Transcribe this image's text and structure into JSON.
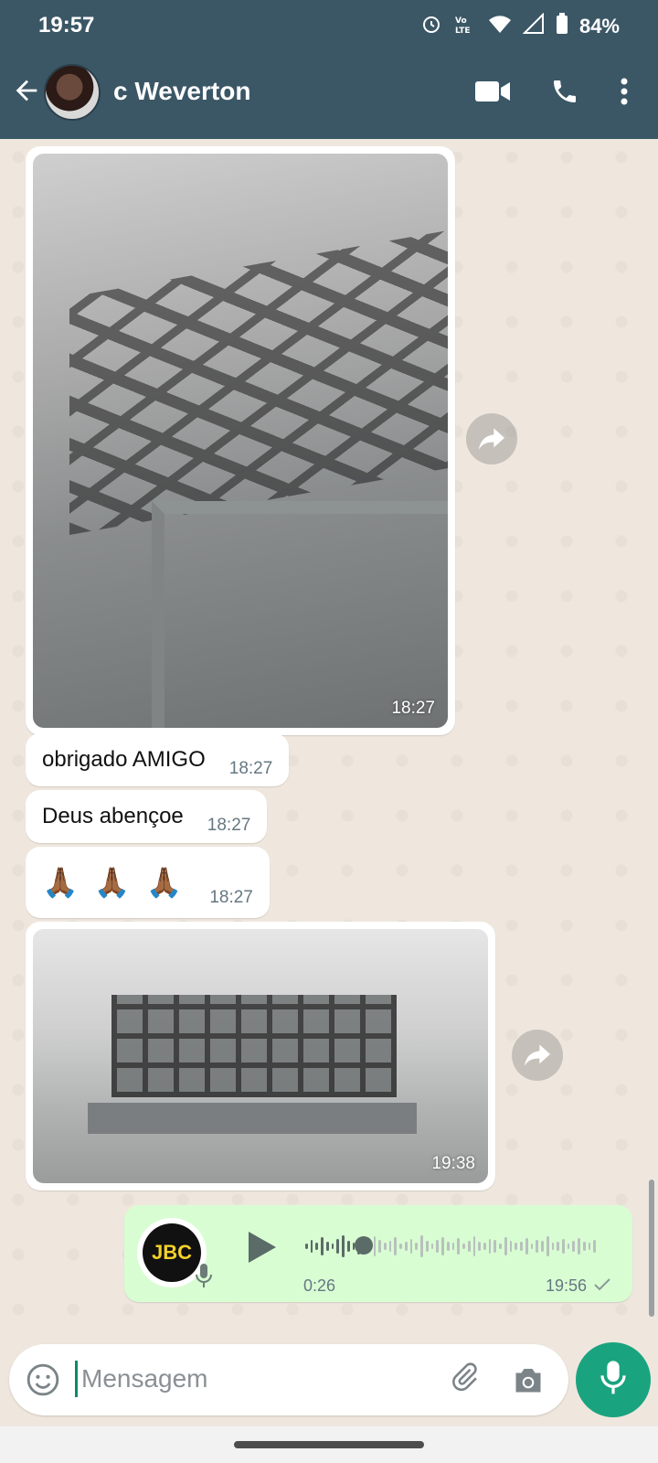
{
  "status_bar": {
    "time": "19:57",
    "battery": "84%",
    "icons": [
      "alarm-icon",
      "volte-icon",
      "wifi-icon",
      "signal-icon",
      "battery-icon"
    ]
  },
  "header": {
    "contact_name": "c Weverton",
    "icons": [
      "back-arrow-icon",
      "video-call-icon",
      "voice-call-icon",
      "more-vert-icon"
    ]
  },
  "messages": [
    {
      "type": "image",
      "time": "18:27"
    },
    {
      "type": "text",
      "text": "obrigado AMIGO",
      "time": "18:27"
    },
    {
      "type": "text",
      "text": "Deus abençoe",
      "time": "18:27"
    },
    {
      "type": "text",
      "text": "🙏🏾 🙏🏾 🙏🏾",
      "time": "18:27"
    },
    {
      "type": "image",
      "time": "19:38"
    },
    {
      "type": "voice",
      "avatar_text": "JBC",
      "duration": "0:26",
      "time": "19:56",
      "played_fraction": 0.2
    }
  ],
  "composer": {
    "placeholder": "Mensagem"
  },
  "colors": {
    "appbar": "#3b5766",
    "chat_bg": "#efe7de",
    "outgoing_bubble": "#d9fdd3",
    "accent": "#1aa37f"
  }
}
